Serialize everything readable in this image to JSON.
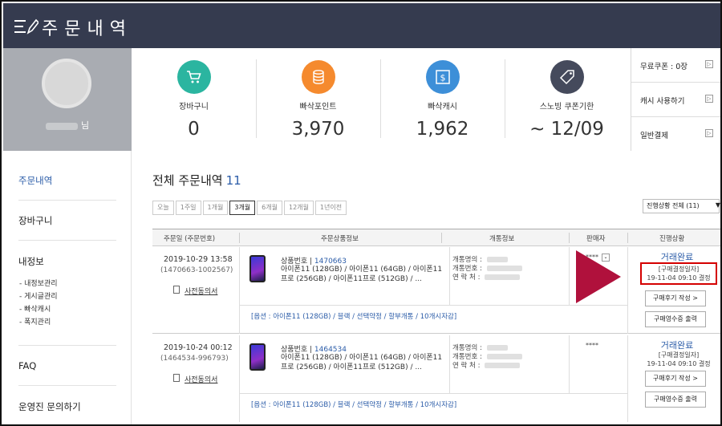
{
  "header": {
    "title": "주문내역"
  },
  "profile": {
    "name_suffix": "님"
  },
  "stats": [
    {
      "label": "장바구니",
      "value": "0",
      "color": "#2bb5a0",
      "icon": "cart-icon"
    },
    {
      "label": "빠삭포인트",
      "value": "3,970",
      "color": "#f58a2e",
      "icon": "coins-icon"
    },
    {
      "label": "빠삭캐시",
      "value": "1,962",
      "color": "#3d8fd8",
      "icon": "cash-icon"
    },
    {
      "label": "스노빙 쿠폰기한",
      "value": "~ 12/09",
      "color": "#454a5c",
      "icon": "tag-icon"
    }
  ],
  "coupons": [
    {
      "label": "무료쿠폰 : 0장"
    },
    {
      "label": "캐시 사용하기"
    },
    {
      "label": "일반결제"
    }
  ],
  "arrow_glyph": "▷",
  "sidebar": {
    "order_history": "주문내역",
    "cart": "장바구니",
    "my_info": "내정보",
    "sub": [
      "- 내정보관리",
      "- 게시글관리",
      "- 빠삭캐시",
      "- 폭지관리"
    ],
    "faq": "FAQ",
    "contact": "운영진 문의하기"
  },
  "main": {
    "title": "전체 주문내역",
    "count": "11",
    "filters": [
      "오늘",
      "1주일",
      "1개월",
      "3개월",
      "6개월",
      "12개월",
      "1년이전"
    ],
    "active_filter": "3개월",
    "status_select": "진행상황 전체 (11)",
    "columns": [
      "주문일 (주문번호)",
      "주문상품정보",
      "개통정보",
      "판매자",
      "진행상황"
    ]
  },
  "orders": [
    {
      "date": "2019-10-29 13:58",
      "number": "(1470663-1002567)",
      "doc": "사전동의서",
      "product_no_label": "상품번호 |",
      "product_no": "1470663",
      "product_name": "아이폰11 (128GB) / 아이폰11 (64GB) / 아이폰11프로 (256GB) / 아이폰11프로 (512GB) / ...",
      "option": "[옵션 : 아이폰11 (128GB) / 블랙 / 선택약정 / 할부개통 / 10개시자감]",
      "act_name": "개통명의 :",
      "act_num": "개통번호 :",
      "act_contact": "연 락 처 :",
      "seller": "****",
      "status": "거래완료",
      "confirm_label": "[구매결정일자]",
      "confirm_date": "19-11-04 09:10 결정",
      "review_btn": "구매후기 작성 >",
      "receipt_btn": "구매영수증 출력"
    },
    {
      "date": "2019-10-24 00:12",
      "number": "(1464534-996793)",
      "doc": "사전동의서",
      "product_no_label": "상품번호 |",
      "product_no": "1464534",
      "product_name": "아이폰11 (128GB) / 아이폰11 (64GB) / 아이폰11프로 (256GB) / 아이폰11프로 (512GB) / ...",
      "option": "[옵션 : 아이폰11 (128GB) / 블랙 / 선택약정 / 할부개통 / 10개시자감]",
      "act_name": "개통명의 :",
      "act_num": "개통번호 :",
      "act_contact": "연 락 처 :",
      "seller": "****",
      "status": "거래완료",
      "confirm_label": "[구매결정일자]",
      "confirm_date": "19-11-04 09:10 결정",
      "review_btn": "구매후기 작성 >",
      "receipt_btn": "구매영수증 출력"
    }
  ]
}
